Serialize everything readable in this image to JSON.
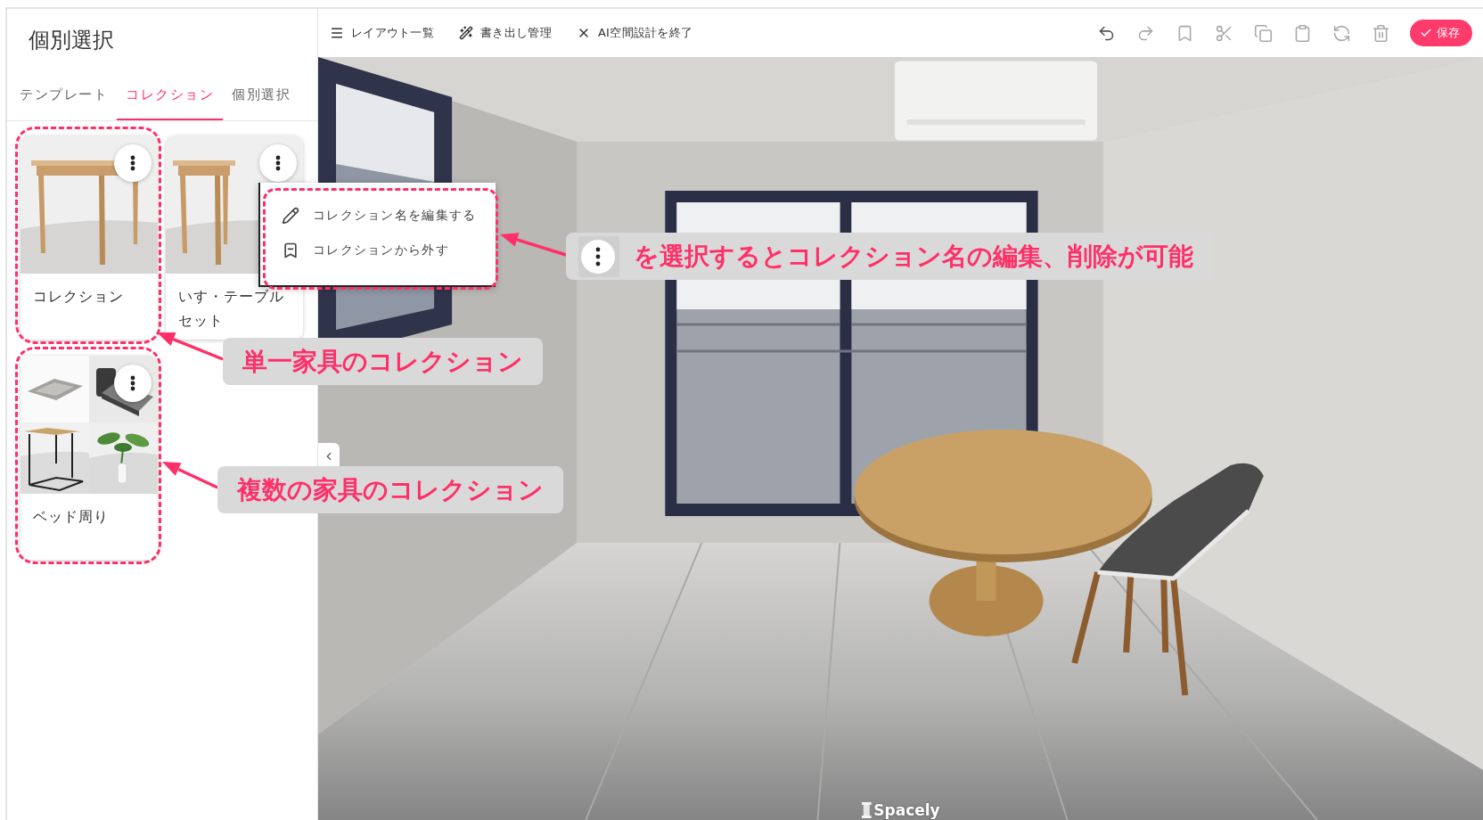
{
  "toolbar": {
    "actions": [
      {
        "label": "レイアウト一覧"
      },
      {
        "label": "書き出し管理"
      },
      {
        "label": "AI空間設計を終了"
      }
    ],
    "tools": [
      {
        "disabled": false
      },
      {
        "disabled": true
      },
      {
        "disabled": true
      },
      {
        "disabled": true
      },
      {
        "disabled": true
      },
      {
        "disabled": true
      },
      {
        "disabled": true
      },
      {
        "disabled": true
      }
    ],
    "save_button": "保存"
  },
  "sidebar": {
    "title": "個別選択",
    "tabs": [
      {
        "label": "テンプレート",
        "selected": false
      },
      {
        "label": "コレクション",
        "selected": true
      },
      {
        "label": "個別選択",
        "selected": false
      }
    ],
    "collections": [
      {
        "name": "コレクション",
        "kind": "single",
        "highlighted": true
      },
      {
        "name": "いす・テーブルセット",
        "kind": "single",
        "highlighted": false
      },
      {
        "name": "ベッド周り",
        "kind": "set",
        "highlighted": true
      }
    ]
  },
  "context_menu": {
    "highlighted": true,
    "items": [
      {
        "label": "コレクション名を編集する"
      },
      {
        "label": "コレクションから外す"
      }
    ]
  },
  "viewer": {
    "logo": "Spacely"
  },
  "annotations": [
    {
      "kind": "icon-note",
      "text": "を選択するとコレクション名の編集、削除が可能"
    },
    {
      "kind": "note",
      "text": "単一家具のコレクション"
    },
    {
      "kind": "note",
      "text": "複数の家具のコレクション"
    }
  ]
}
